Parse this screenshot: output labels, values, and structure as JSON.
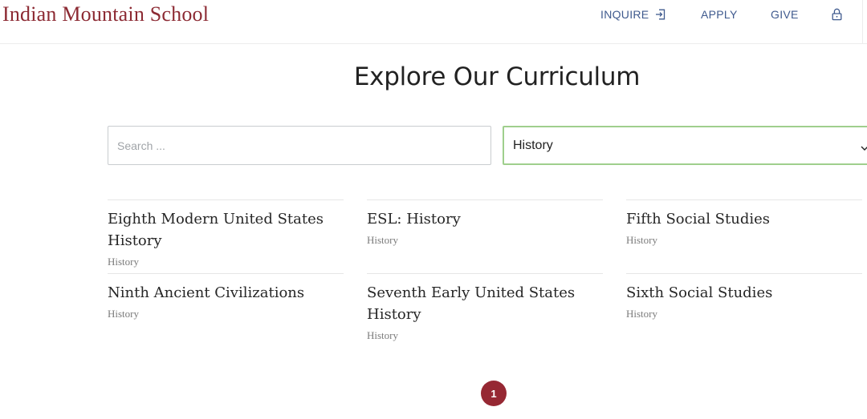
{
  "header": {
    "logo_text": "Indian Mountain School",
    "nav": {
      "inquire": "INQUIRE",
      "apply": "APPLY",
      "give": "GIVE"
    },
    "icons": {
      "inquire": "sign-in-icon",
      "lock": "lock-icon"
    }
  },
  "main": {
    "title": "Explore Our Curriculum",
    "search": {
      "placeholder": "Search ...",
      "value": ""
    },
    "category_filter": {
      "selected": "History"
    },
    "courses": [
      {
        "title": "Eighth Modern United States History",
        "category": "History"
      },
      {
        "title": "ESL: History",
        "category": "History"
      },
      {
        "title": "Fifth Social Studies",
        "category": "History"
      },
      {
        "title": "Ninth Ancient Civilizations",
        "category": "History"
      },
      {
        "title": "Seventh Early United States History",
        "category": "History"
      },
      {
        "title": "Sixth Social Studies",
        "category": "History"
      }
    ],
    "pagination": {
      "current_page": "1"
    }
  },
  "colors": {
    "brand": "#8c2a33",
    "nav": "#3f5a8e",
    "select_border": "#9fcf8d",
    "page_bubble": "#962833"
  }
}
